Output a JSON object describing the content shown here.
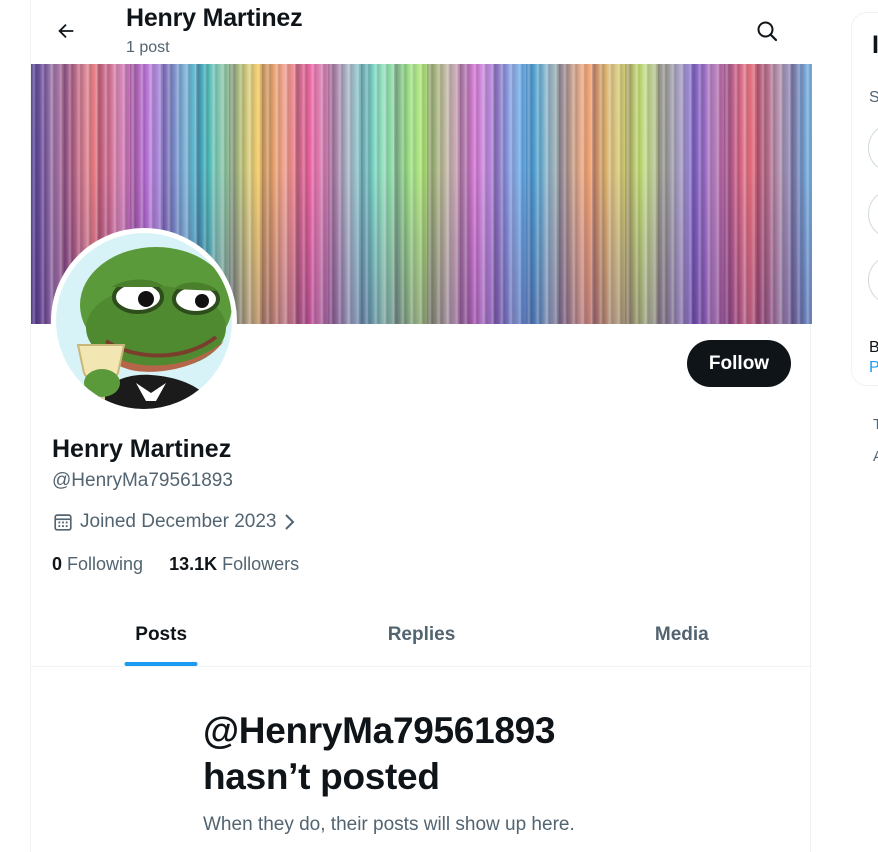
{
  "header": {
    "title": "Henry Martinez",
    "post_count": "1 post",
    "back_icon": "arrow-left-icon",
    "search_icon": "search-icon"
  },
  "profile": {
    "name": "Henry Martinez",
    "handle": "@HenryMa79561893",
    "joined": "Joined December 2023",
    "follow_label": "Follow",
    "following_count": "0",
    "following_label": "Following",
    "followers_count": "13.1K",
    "followers_label": "Followers"
  },
  "tabs": [
    {
      "label": "Posts",
      "active": true
    },
    {
      "label": "Replies",
      "active": false
    },
    {
      "label": "Media",
      "active": false
    }
  ],
  "empty_state": {
    "title_line1": "@HenryMa79561893",
    "title_line2": "hasn’t posted",
    "subtitle": "When they do, their posts will show up here."
  },
  "sidebar": {
    "heading_fragment": "I",
    "sub_fragment": "S",
    "line_b_fragment": "B",
    "line_p_fragment": "P",
    "footer_t_fragment": "T",
    "footer_a_fragment": "A"
  },
  "colors": {
    "accent": "#1d9bf0",
    "text_primary": "#0f1419",
    "text_secondary": "#536471",
    "button_bg": "#0f1419"
  }
}
